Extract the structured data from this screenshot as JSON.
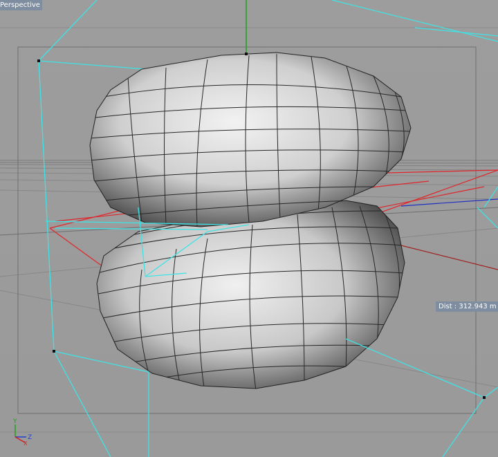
{
  "viewport": {
    "label": "Perspective",
    "readout": "Dist : 312.943 m"
  },
  "axis_gizmo": {
    "y_label": "Y",
    "z_label": "Z",
    "x_label": "X"
  },
  "colors": {
    "background": "#9a9a9a",
    "bounding_box": "#3fe3e6",
    "selection": "#e0262b",
    "grid_line": "#808080",
    "mesh_edge": "#222222",
    "label_bg": "#7f8da0",
    "axis_x": "#d02020",
    "axis_y": "#20a020",
    "axis_z": "#2040d0"
  },
  "icons": {
    "axis": "xyz-axis-icon"
  }
}
